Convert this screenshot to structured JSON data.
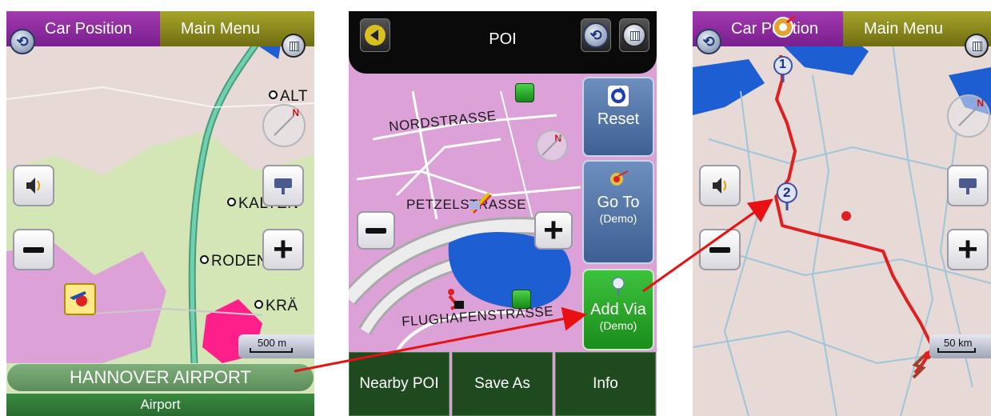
{
  "colors": {
    "map_pink": "#dca2d8",
    "map_green": "#d4e6b6",
    "map_water": "#1d5fd3",
    "route_red": "#e02020",
    "arrow_red": "#e81010",
    "highway_green": "#5fbfa0",
    "rural_map": "#e6d9d6",
    "forest_green": "#2f9a3a",
    "button_green": "#2aa82a",
    "button_blue": "#4d72a8"
  },
  "screen1": {
    "tabs": {
      "car_position": "Car Position",
      "main_menu": "Main Menu"
    },
    "cities": [
      "ALT",
      "KALTEN",
      "RODENBU",
      "KRÄ"
    ],
    "compass_north": "N",
    "scale": "500 m",
    "address": "HANNOVER AIRPORT",
    "category": "Airport",
    "icons": [
      "nav-logo-icon",
      "menu-grid-icon",
      "speaker-icon",
      "zoom-out-icon",
      "zoom-in-icon",
      "keyboard-icon",
      "airport-poi-icon"
    ]
  },
  "screen2": {
    "title": "POI",
    "streets": [
      "NORDSTRASSE",
      "PETZELSTRASSE",
      "FLUGHAFENSTRASSE"
    ],
    "compass_north": "N",
    "side_buttons": [
      {
        "label": "Reset",
        "sub": ""
      },
      {
        "label": "Go To",
        "sub": "(Demo)"
      },
      {
        "label": "Add Via",
        "sub": "(Demo)"
      }
    ],
    "bottom_buttons": [
      "Nearby POI",
      "Save As",
      "Info"
    ],
    "icons": [
      "back-arrow-icon",
      "nav-logo-icon",
      "menu-grid-icon",
      "reset-icon",
      "goto-flag-icon",
      "add-via-pin-icon"
    ]
  },
  "screen3": {
    "tabs": {
      "car_position": "Car Position",
      "main_menu": "Main Menu"
    },
    "compass_north": "N",
    "scale": "50 km",
    "via_points": [
      "1",
      "2"
    ],
    "icons": [
      "nav-logo-icon",
      "menu-grid-icon",
      "speaker-icon",
      "zoom-out-icon",
      "zoom-in-icon",
      "keyboard-icon",
      "destination-flag-icon",
      "start-flag-icon"
    ]
  }
}
